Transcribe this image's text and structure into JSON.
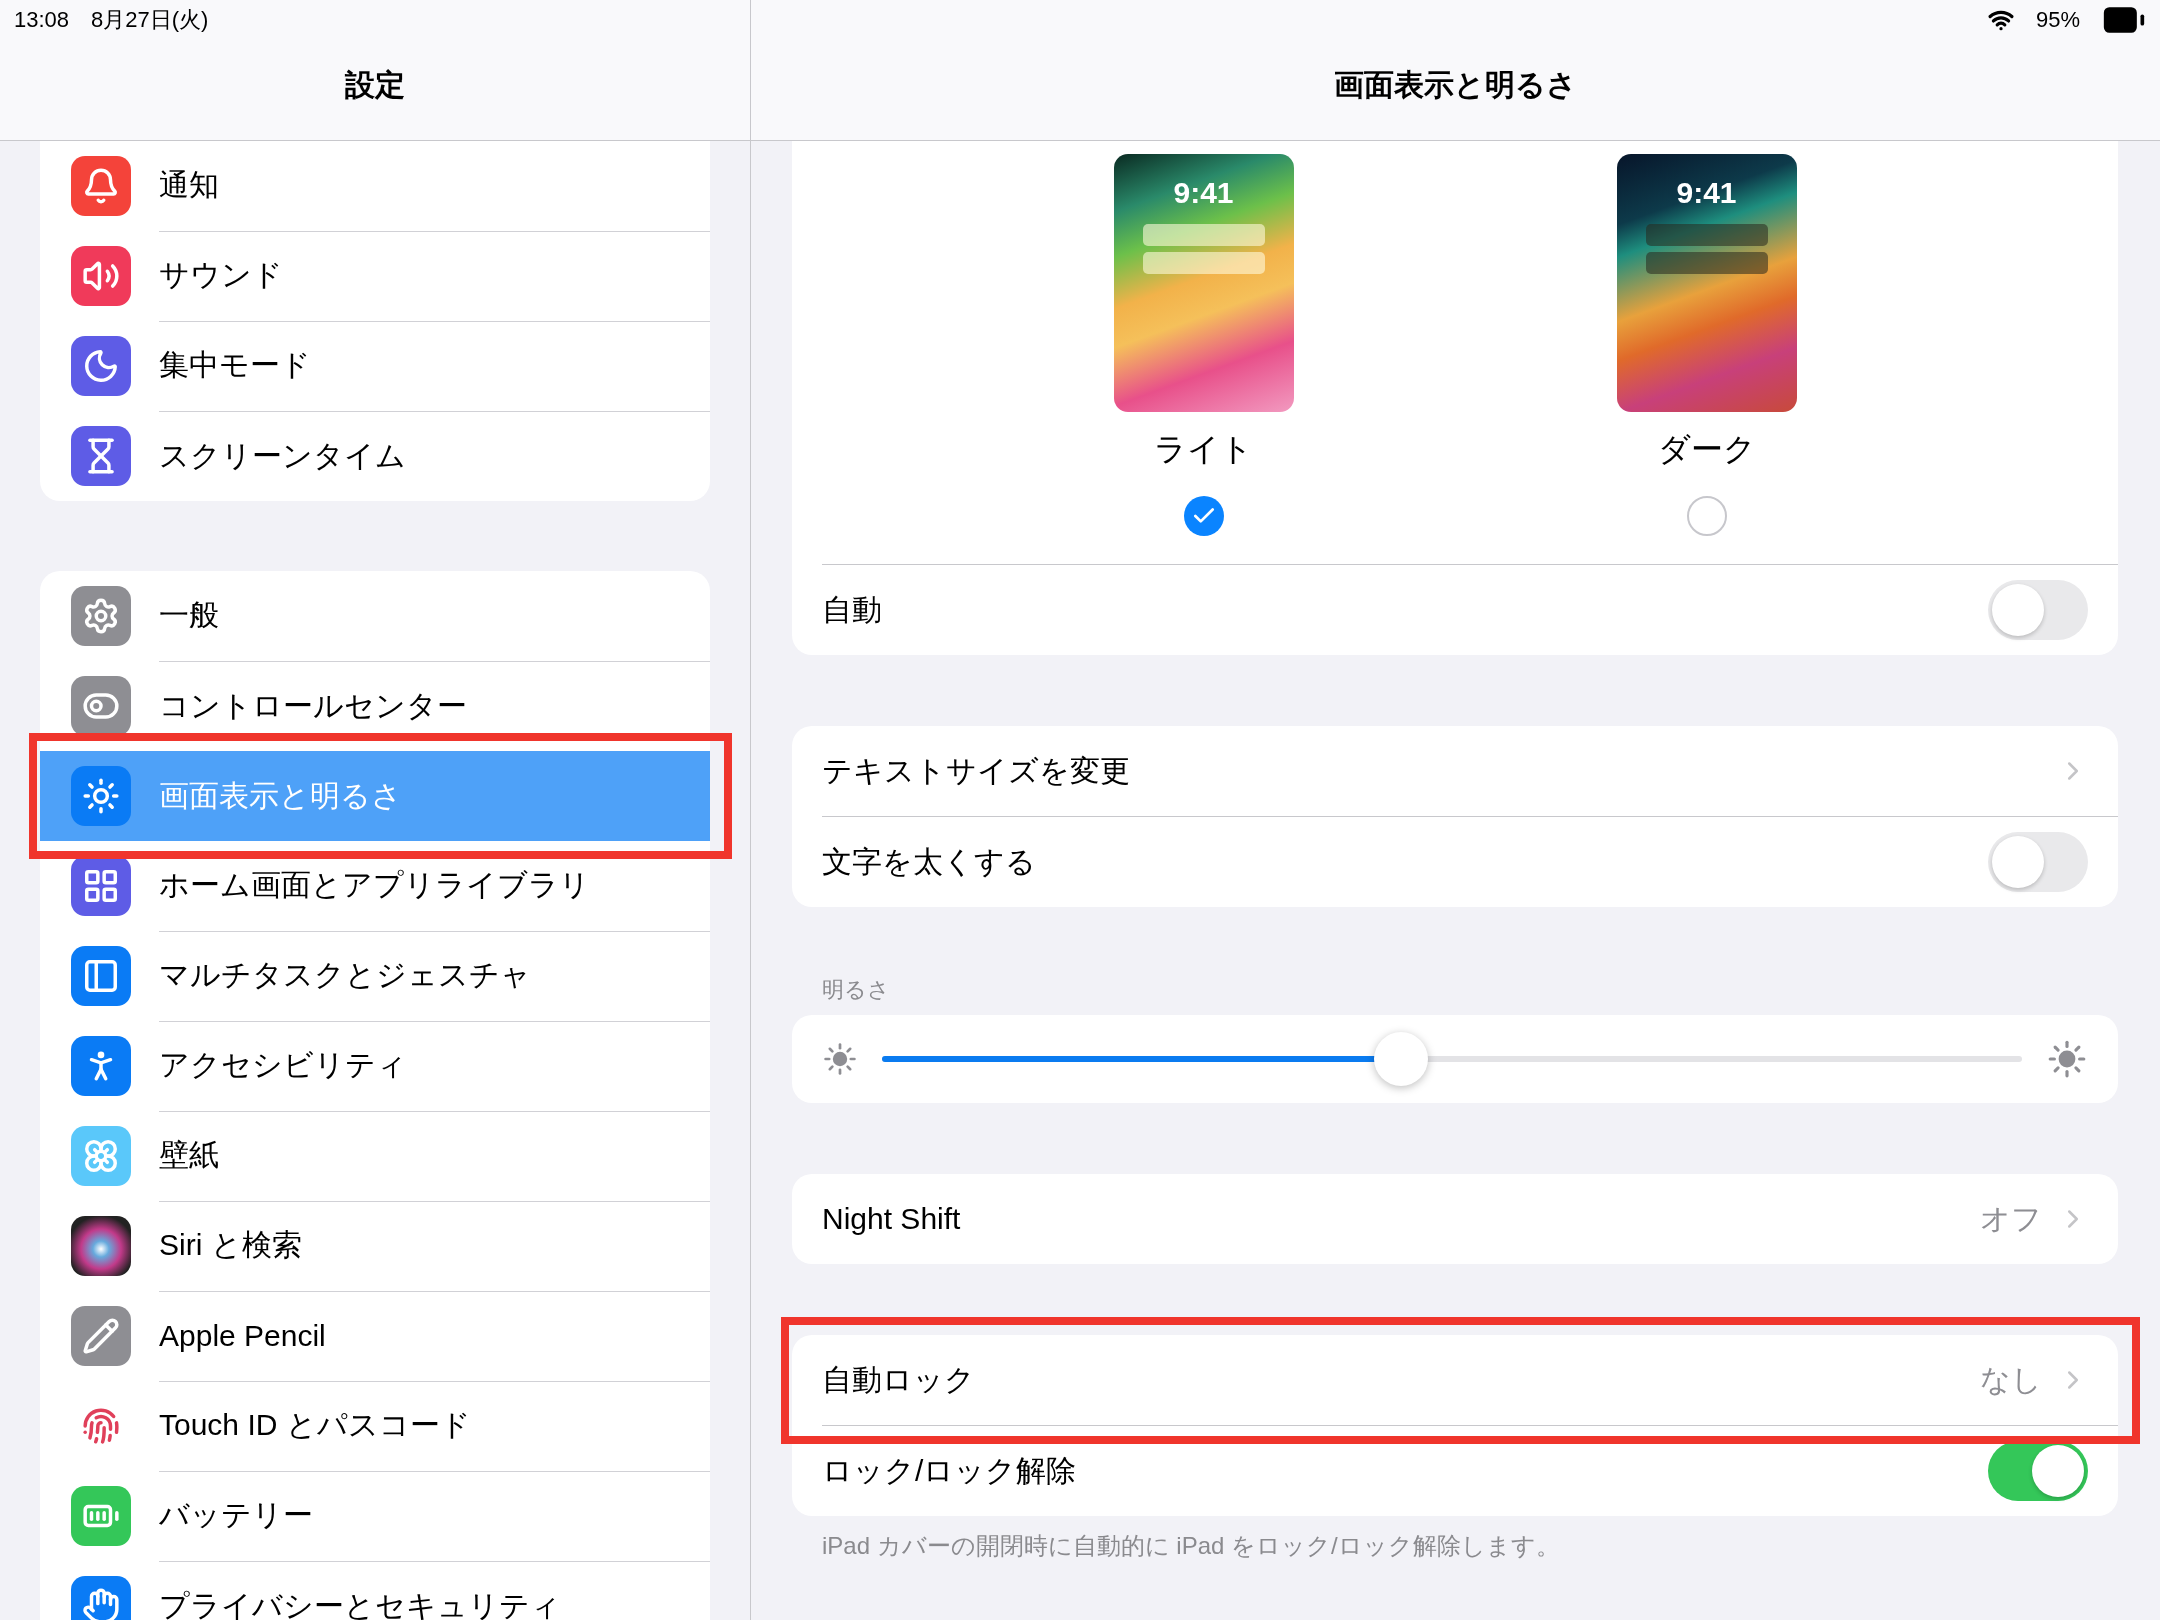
{
  "status_bar": {
    "time": "13:08",
    "date": "8月27日(火)",
    "battery": "95%"
  },
  "sidebar": {
    "title": "設定",
    "groups": [
      {
        "items": [
          {
            "label": "通知",
            "selected": false,
            "annotated": false
          },
          {
            "label": "サウンド",
            "selected": false,
            "annotated": false
          },
          {
            "label": "集中モード",
            "selected": false,
            "annotated": false
          },
          {
            "label": "スクリーンタイム",
            "selected": false,
            "annotated": false
          }
        ]
      },
      {
        "items": [
          {
            "label": "一般",
            "selected": false,
            "annotated": false
          },
          {
            "label": "コントロールセンター",
            "selected": false,
            "annotated": false
          },
          {
            "label": "画面表示と明るさ",
            "selected": true,
            "annotated": true
          },
          {
            "label": "ホーム画面とアプリライブラリ",
            "selected": false,
            "annotated": false
          },
          {
            "label": "マルチタスクとジェスチャ",
            "selected": false,
            "annotated": false
          },
          {
            "label": "アクセシビリティ",
            "selected": false,
            "annotated": false
          },
          {
            "label": "壁紙",
            "selected": false,
            "annotated": false
          },
          {
            "label": "Siri と検索",
            "selected": false,
            "annotated": false
          },
          {
            "label": "Apple Pencil",
            "selected": false,
            "annotated": false
          },
          {
            "label": "Touch ID とパスコード",
            "selected": false,
            "annotated": false
          },
          {
            "label": "バッテリー",
            "selected": false,
            "annotated": false
          },
          {
            "label": "プライバシーとセキュリティ",
            "selected": false,
            "annotated": false
          }
        ]
      }
    ]
  },
  "detail": {
    "title": "画面表示と明るさ",
    "appearance": {
      "options": [
        {
          "kind": "light",
          "time": "9:41",
          "label": "ライト",
          "selected": true
        },
        {
          "kind": "dark",
          "time": "9:41",
          "label": "ダーク",
          "selected": false
        }
      ],
      "auto": {
        "label": "自動",
        "on": false
      }
    },
    "groups": [
      {
        "rows": [
          {
            "kind": "link",
            "label": "テキストサイズを変更"
          },
          {
            "kind": "toggle",
            "label": "文字を太くする",
            "on": false
          }
        ]
      },
      {
        "header": "明るさ",
        "rows": [
          {
            "kind": "slider",
            "level": 0.455
          }
        ]
      },
      {
        "rows": [
          {
            "kind": "link",
            "label": "Night Shift",
            "value": "オフ"
          }
        ]
      },
      {
        "rows": [
          {
            "kind": "link",
            "label": "自動ロック",
            "value": "なし",
            "annotated": true
          },
          {
            "kind": "toggle",
            "label": "ロック/ロック解除",
            "on": true
          }
        ],
        "footnote": "iPad カバーの開閉時に自動的に iPad をロック/ロック解除します。"
      }
    ]
  }
}
